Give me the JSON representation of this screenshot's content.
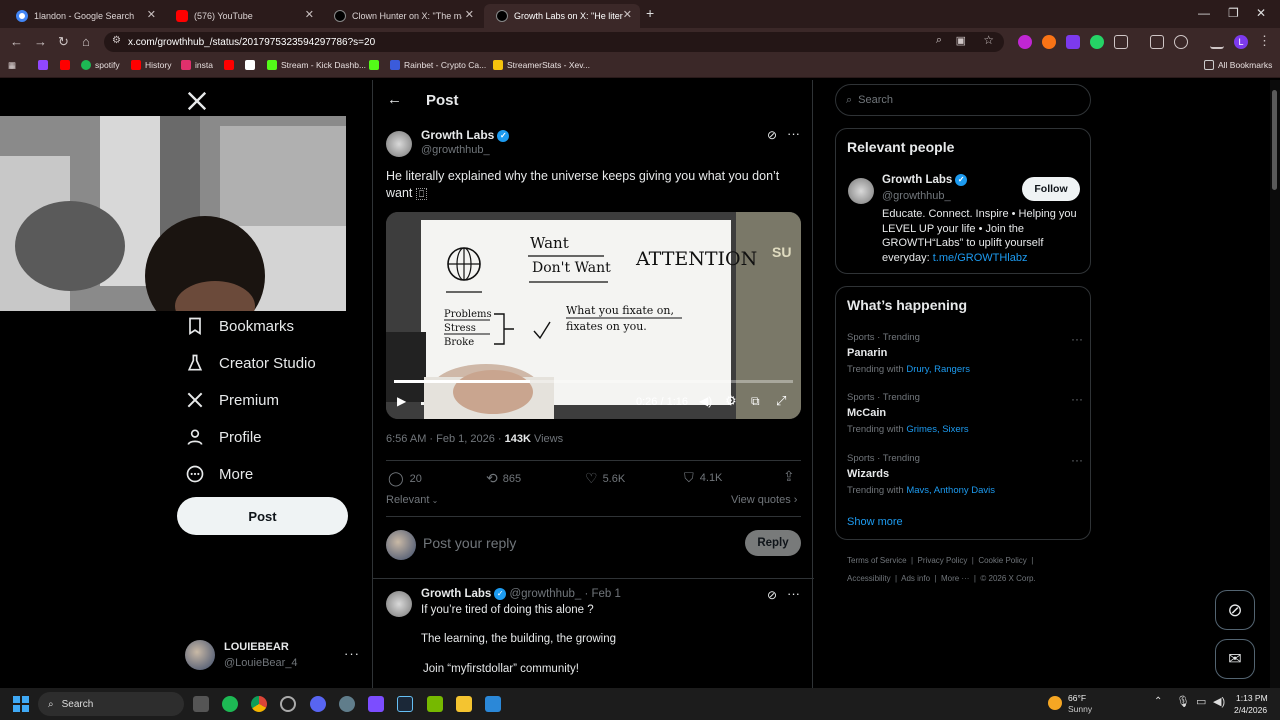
{
  "browser": {
    "tabs": [
      {
        "title": "1landon - Google Search",
        "color": "#4285f4"
      },
      {
        "title": "(576) YouTube",
        "color": "#ff0000"
      },
      {
        "title": "Clown Hunter on X: \"The male",
        "color": "#1a1a1a"
      },
      {
        "title": "Growth Labs on X: \"He liter",
        "color": "#1a1a1a"
      }
    ],
    "url": "x.com/growthhub_/status/2017975323594297786?s=20",
    "bookmarks": [
      {
        "label": "",
        "color": "#9147ff"
      },
      {
        "label": "",
        "color": "#ff0000"
      },
      {
        "label": "spotify",
        "color": "#1db954"
      },
      {
        "label": "History",
        "color": "#ff0000"
      },
      {
        "label": "insta",
        "color": "#e1306c"
      },
      {
        "label": "",
        "color": "#ff0000"
      },
      {
        "label": "",
        "color": "#ffffff"
      },
      {
        "label": "Stream - Kick Dashb...",
        "color": "#53fc18"
      },
      {
        "label": "",
        "color": "#53fc18"
      },
      {
        "label": "Rainbet - Crypto Ca...",
        "color": "#3b5bdb"
      },
      {
        "label": "StreamerStats - Xev...",
        "color": "#f4c20d"
      }
    ],
    "all_bookmarks": "All Bookmarks"
  },
  "left_nav": {
    "items": [
      {
        "label": "Bookmarks",
        "icon": "bookmark-icon"
      },
      {
        "label": "Creator Studio",
        "icon": "flask-icon"
      },
      {
        "label": "Premium",
        "icon": "x-logo-icon"
      },
      {
        "label": "Profile",
        "icon": "person-icon"
      },
      {
        "label": "More",
        "icon": "more-circle-icon"
      }
    ],
    "post_button": "Post",
    "account": {
      "name": "LOUIEBEAR",
      "handle": "@LouieBear_4"
    }
  },
  "post": {
    "header": "Post",
    "author": "Growth Labs",
    "handle": "@growthhub_",
    "text": "He literally explained why the universe keeps giving you what you don’t want",
    "text_tail": "⎕",
    "video": {
      "time": "0:26 / 1:16",
      "progress": 0.342,
      "whiteboard": {
        "want": "Want",
        "dont_want": "Don't Want",
        "attention": "ATTENTION",
        "problems": "Problems",
        "stress": "Stress",
        "broke": "Broke",
        "fixate1": "What you fixate on,",
        "fixate2": "fixates on you.",
        "side": "SU"
      }
    },
    "meta_time": "6:56 AM · Feb 1, 2026 · ",
    "views_count": "143K",
    "views_label": " Views",
    "stats": {
      "replies": "20",
      "reposts": "865",
      "likes": "5.6K",
      "bookmarks": "4.1K"
    },
    "relevant": "Relevant",
    "view_quotes": "View quotes",
    "reply_placeholder": "Post your reply",
    "reply_button": "Reply",
    "reply_post": {
      "author": "Growth Labs",
      "handle": "@growthhub_ · Feb 1",
      "line1": "If you’re tired of doing this alone ?",
      "line2": "The learning, the building, the growing",
      "line3": "Join “myfirstdollar” community!"
    }
  },
  "right": {
    "search_placeholder": "Search",
    "relevant_people": {
      "title": "Relevant people",
      "name": "Growth Labs",
      "handle": "@growthhub_",
      "follow": "Follow",
      "bio": "Educate. Connect. Inspire • Helping you LEVEL UP your life • Join the GROWTH“Labs” to uplift yourself everyday: ",
      "link": "t.me/GROWTHlabz"
    },
    "happening": {
      "title": "What’s happening",
      "trends": [
        {
          "category": "Sports · Trending",
          "name": "Panarin",
          "with_label": "Trending with ",
          "with": "Drury, Rangers"
        },
        {
          "category": "Sports · Trending",
          "name": "McCain",
          "with_label": "Trending with ",
          "with": "Grimes, Sixers"
        },
        {
          "category": "Sports · Trending",
          "name": "Wizards",
          "with_label": "Trending with ",
          "with": "Mavs, Anthony Davis"
        }
      ],
      "show_more": "Show more"
    },
    "footer": {
      "line1": [
        "Terms of Service",
        "Privacy Policy",
        "Cookie Policy"
      ],
      "line2": [
        "Accessibility",
        "Ads info",
        "More ···",
        "© 2026 X Corp."
      ]
    }
  },
  "taskbar": {
    "search": "Search",
    "weather_temp": "66°F",
    "weather_desc": "Sunny",
    "time": "1:13 PM",
    "date": "2/4/2026"
  }
}
